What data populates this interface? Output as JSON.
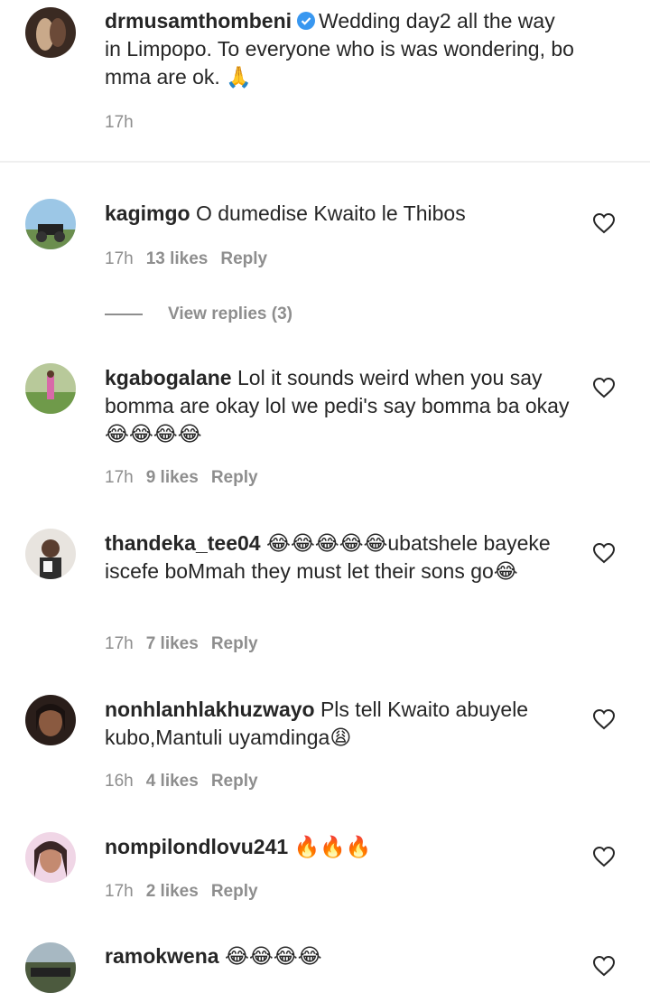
{
  "caption": {
    "username": "drmusamthombeni",
    "text": "Wedding day2 all the way in Limpopo. To everyone who is was wondering, bo mma are ok. 🙏",
    "time": "17h"
  },
  "comments": [
    {
      "username": "kagimgo",
      "text": "O dumedise Kwaito le Thibos",
      "time": "17h",
      "likes": "13 likes",
      "reply": "Reply"
    },
    {
      "username": "kgabogalane",
      "text": "Lol it sounds weird when you say bomma are okay lol we pedi's say bomma ba okay😂😂😂😂",
      "time": "17h",
      "likes": "9 likes",
      "reply": "Reply"
    },
    {
      "username": "thandeka_tee04",
      "text": "😂😂😂😂😂ubatshele bayeke iscefe boMmah they must let their sons go😂",
      "time": "17h",
      "likes": "7 likes",
      "reply": "Reply"
    },
    {
      "username": "nonhlanhlakhuzwayo",
      "text": "Pls tell Kwaito abuyele kubo,Mantuli uyamdinga😩",
      "time": "16h",
      "likes": "4 likes",
      "reply": "Reply"
    },
    {
      "username": "nompilondlovu241",
      "text": "🔥🔥🔥",
      "time": "17h",
      "likes": "2 likes",
      "reply": "Reply"
    },
    {
      "username": "ramokwena",
      "text": "😂😂😂😂"
    }
  ],
  "view_replies": "View replies (3)",
  "icons": {
    "verified": "verified-badge-icon",
    "heart": "heart-outline-icon"
  },
  "colors": {
    "secondary_text": "#8e8e8e",
    "verified": "#3897f0"
  }
}
